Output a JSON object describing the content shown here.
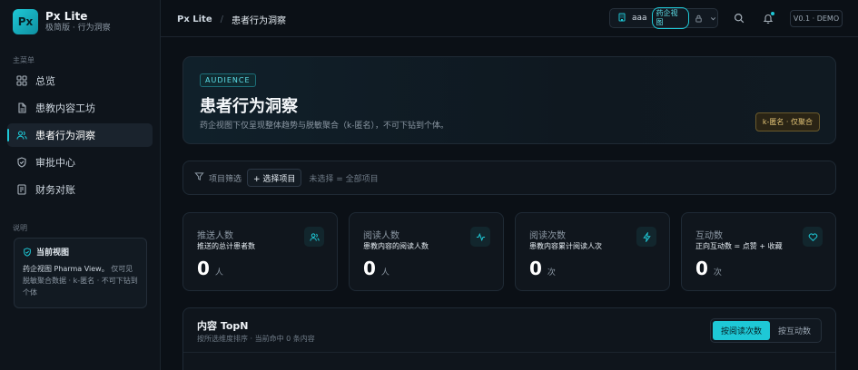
{
  "colors": {
    "accent": "#1ec8d6",
    "gold": "#e5c678",
    "bg": "#0b1016"
  },
  "brand": {
    "logo": "Px",
    "name": "Px Lite",
    "subtitle": "极简版 · 行为洞察"
  },
  "sidebar": {
    "section_label": "主菜单",
    "items": [
      {
        "label": "总览",
        "icon": "grid-icon"
      },
      {
        "label": "患教内容工坊",
        "icon": "document-icon"
      },
      {
        "label": "患者行为洞察",
        "icon": "users-icon",
        "active": true
      },
      {
        "label": "审批中心",
        "icon": "shield-icon"
      },
      {
        "label": "财务对账",
        "icon": "ledger-icon"
      }
    ],
    "note_label": "说明",
    "info_card": {
      "title": "当前视图",
      "body_highlight": "药企视图 Pharma View。",
      "body_rest": "仅可见脱敏聚合数据 · k-匿名 · 不可下钻到个体"
    }
  },
  "header": {
    "breadcrumb_root": "Px Lite",
    "breadcrumb_sep": "/",
    "breadcrumb_current": "患者行为洞察",
    "user_name": "aaa",
    "role_badge": "药企视图",
    "version": "V0.1 · DEMO"
  },
  "hero": {
    "tag": "AUDIENCE",
    "title": "患者行为洞察",
    "description": "药企视图下仅呈现整体趋势与脱敏聚合（k-匿名），不可下钻到个体。",
    "badge": "k-匿名 · 仅聚合"
  },
  "filter": {
    "label": "项目筛选",
    "button": "+ 选择项目",
    "status": "未选择 = 全部项目"
  },
  "stats": [
    {
      "title": "推送人数",
      "subtitle": "推送的总计患者数",
      "value": "0",
      "unit": "人",
      "icon": "users-icon"
    },
    {
      "title": "阅读人数",
      "subtitle": "患教内容的阅读人数",
      "value": "0",
      "unit": "人",
      "icon": "activity-icon"
    },
    {
      "title": "阅读次数",
      "subtitle": "患教内容累计阅读人次",
      "value": "0",
      "unit": "次",
      "icon": "zap-icon"
    },
    {
      "title": "互动数",
      "subtitle": "正向互动数 = 点赞 + 收藏",
      "value": "0",
      "unit": "次",
      "icon": "heart-icon"
    }
  ],
  "topn": {
    "title": "内容 TopN",
    "subtitle": "按所选维度排序 · 当前命中 0 条内容",
    "toggle": [
      "按阅读次数",
      "按互动数"
    ]
  }
}
